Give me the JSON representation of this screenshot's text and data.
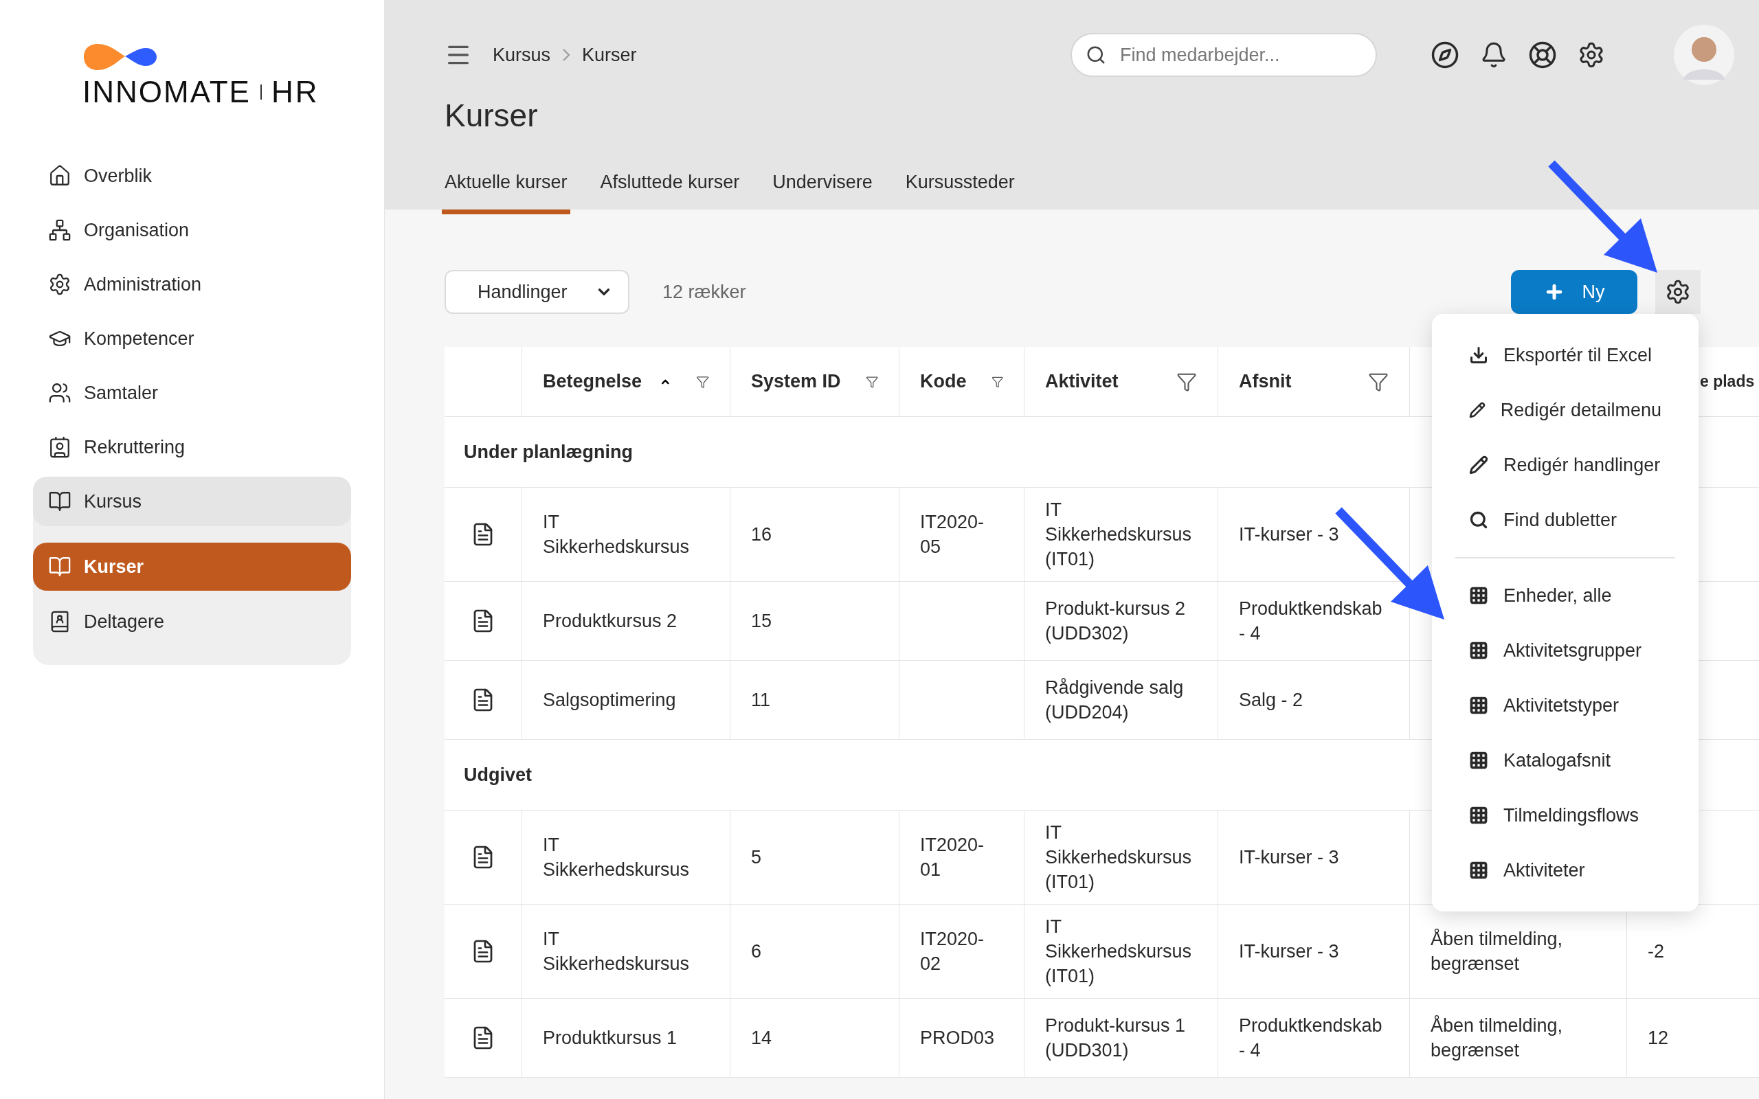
{
  "logo": {
    "name": "INNOMATE",
    "suffix": "HR"
  },
  "nav": [
    {
      "label": "Overblik",
      "selected": false
    },
    {
      "label": "Organisation",
      "selected": false
    },
    {
      "label": "Administration",
      "selected": false
    },
    {
      "label": "Kompetencer",
      "selected": false
    },
    {
      "label": "Samtaler",
      "selected": false
    },
    {
      "label": "Rekruttering",
      "selected": false
    },
    {
      "label": "Kursus",
      "selected": false,
      "expanded": true,
      "children": [
        {
          "label": "Kurser",
          "selected": true
        },
        {
          "label": "Deltagere",
          "selected": false
        }
      ]
    }
  ],
  "breadcrumb": [
    "Kursus",
    "Kurser"
  ],
  "search": {
    "placeholder": "Find medarbejder..."
  },
  "page_title": "Kurser",
  "tabs": [
    {
      "label": "Aktuelle kurser",
      "selected": true
    },
    {
      "label": "Afsluttede kurser",
      "selected": false
    },
    {
      "label": "Undervisere",
      "selected": false
    },
    {
      "label": "Kursussteder",
      "selected": false
    }
  ],
  "toolbar": {
    "actions_dropdown": "Handlinger",
    "row_count": "12 rækker",
    "new_button": "Ny"
  },
  "table": {
    "columns": [
      {
        "label": "Betegnelse",
        "sorted": true,
        "filter": true
      },
      {
        "label": "System ID",
        "filter": true
      },
      {
        "label": "Kode",
        "filter": true
      },
      {
        "label": "Aktivitet",
        "filter": true
      },
      {
        "label": "Afsnit",
        "filter": true
      },
      {},
      {
        "label": "e plads"
      }
    ],
    "groups": [
      {
        "label": "Under planlægning",
        "rows": [
          {
            "cells": [
              "IT Sikkerhedskursus",
              "16",
              "IT2020-05",
              "IT Sikkerhedskursus (IT01)",
              "IT-kurser - 3"
            ]
          },
          {
            "cells": [
              "Produktkursus 2",
              "15",
              null,
              "Produkt-kursus 2 (UDD302)",
              "Produktkendskab - 4"
            ]
          },
          {
            "cells": [
              "Salgsoptimering",
              "11",
              null,
              "Rådgivende salg (UDD204)",
              "Salg - 2"
            ]
          }
        ]
      },
      {
        "label": "Udgivet",
        "rows": [
          {
            "cells": [
              "IT Sikkerhedskursus",
              "5",
              "IT2020-01",
              "IT Sikkerhedskursus (IT01)",
              "IT-kurser - 3"
            ]
          },
          {
            "cells": [
              "IT Sikkerhedskursus",
              "6",
              "IT2020-02",
              "IT Sikkerhedskursus (IT01)",
              "IT-kurser - 3",
              "Åben tilmelding, begrænset",
              "-2"
            ]
          },
          {
            "cells": [
              "Produktkursus 1",
              "14",
              "PROD03",
              "Produkt-kursus 1 (UDD301)",
              "Produktkendskab - 4",
              "Åben tilmelding, begrænset",
              "12"
            ]
          }
        ]
      }
    ]
  },
  "settings_menu": {
    "groups": [
      [
        {
          "label": "Eksportér til Excel",
          "kind": "export"
        },
        {
          "label": "Redigér detailmenu",
          "kind": "edit"
        },
        {
          "label": "Redigér handlinger",
          "kind": "edit"
        },
        {
          "label": "Find dubletter",
          "kind": "search"
        }
      ],
      [
        {
          "label": "Enheder, alle",
          "kind": "grid"
        },
        {
          "label": "Aktivitetsgrupper",
          "kind": "grid"
        },
        {
          "label": "Aktivitetstyper",
          "kind": "grid"
        },
        {
          "label": "Katalogafsnit",
          "kind": "grid"
        },
        {
          "label": "Tilmeldingsflows",
          "kind": "grid"
        },
        {
          "label": "Aktiviteter",
          "kind": "grid"
        }
      ]
    ]
  }
}
